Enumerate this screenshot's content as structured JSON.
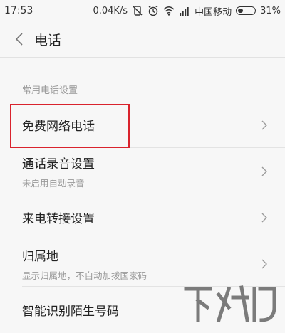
{
  "status_bar": {
    "time": "17:53",
    "net_speed": "0.04K/s",
    "carrier": "中国移动",
    "battery_percent": "31%",
    "battery_level": 0.31,
    "icons": [
      "vibrate-off-icon",
      "alarm-icon",
      "wifi-icon",
      "signal-icon",
      "battery-icon"
    ]
  },
  "header": {
    "back_icon": "chevron-left-icon",
    "title": "电话"
  },
  "section": {
    "title": "常用电话设置"
  },
  "items": [
    {
      "label": "免费网络电话",
      "sub": ""
    },
    {
      "label": "通话录音设置",
      "sub": "未启用自动录音"
    },
    {
      "label": "来电转接设置",
      "sub": ""
    },
    {
      "label": "归属地",
      "sub": "显示归属地，不自动加拨国家码"
    },
    {
      "label": "智能识别陌生号码",
      "sub": ""
    }
  ],
  "colors": {
    "highlight": "#d9232d",
    "background": "#f7f7f7",
    "secondary_text": "#999999"
  }
}
